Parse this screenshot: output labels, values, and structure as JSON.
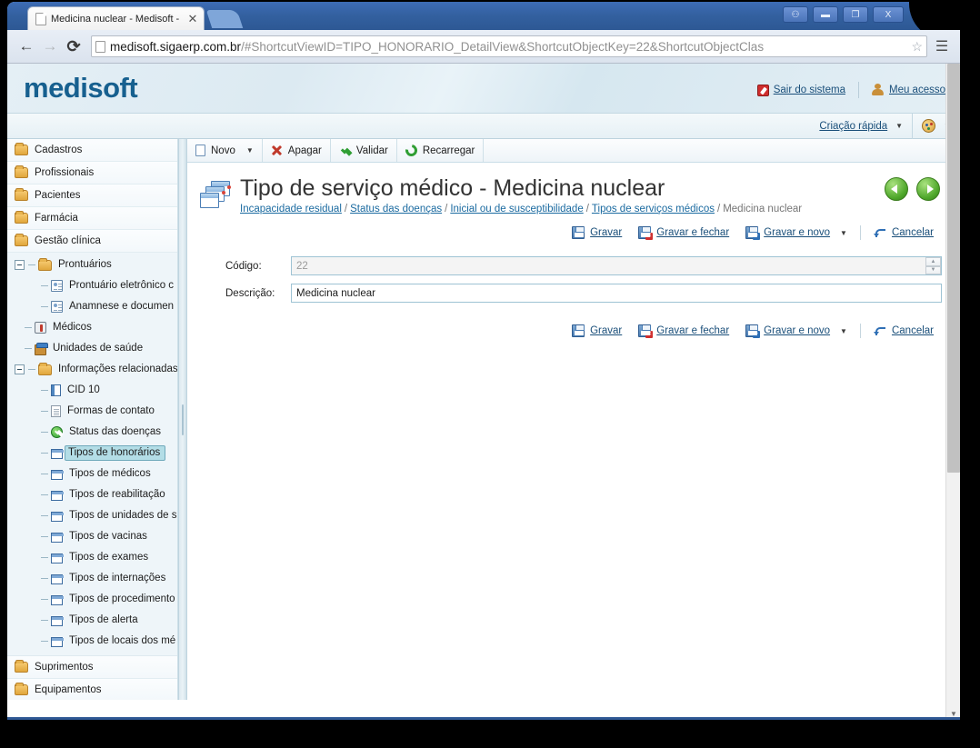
{
  "browser": {
    "tab": {
      "title": "Medicina nuclear - Medisoft -",
      "close_label": "✕",
      "favicon": "page-icon"
    },
    "nav": {
      "back": "←",
      "forward": "→",
      "reload": "⟳",
      "menu": "☰",
      "star": "☆"
    },
    "url": {
      "host": "medisoft.sigaerp.com.br",
      "rest": "/#ShortcutViewID=TIPO_HONORARIO_DetailView&ShortcutObjectKey=22&ShortcutObjectClas"
    },
    "window_controls": {
      "user": "⚇",
      "minimize": "▬",
      "restore": "❐",
      "close": "X"
    }
  },
  "app": {
    "brand": "medisoft",
    "header_links": [
      {
        "label": "Sair do sistema",
        "icon": "exit-icon"
      },
      {
        "label": "Meu acesso",
        "icon": "user-icon"
      }
    ],
    "sub_header": {
      "quick_create": "Criação rápida",
      "caret": "▼",
      "theme_icon": "palette-icon"
    }
  },
  "sidebar": {
    "roots_top": [
      {
        "label": "Cadastros",
        "icon": "folder-icon"
      },
      {
        "label": "Profissionais",
        "icon": "folder-icon"
      },
      {
        "label": "Pacientes",
        "icon": "folder-icon"
      },
      {
        "label": "Farmácia",
        "icon": "folder-icon"
      },
      {
        "label": "Gestão clínica",
        "icon": "folder-icon"
      }
    ],
    "tree": [
      {
        "label": "Prontuários",
        "icon": "folder-icon",
        "level": 1,
        "expander": "minus",
        "selected": false
      },
      {
        "label": "Prontuário eletrônico c",
        "icon": "card-icon",
        "level": 2,
        "expander": "none",
        "selected": false
      },
      {
        "label": "Anamnese e documen",
        "icon": "card-icon",
        "level": 2,
        "expander": "none",
        "selected": false
      },
      {
        "label": "Médicos",
        "icon": "doctor-icon",
        "level": 1,
        "expander": "none",
        "selected": false
      },
      {
        "label": "Unidades de saúde",
        "icon": "hospital-icon",
        "level": 1,
        "expander": "none",
        "selected": false
      },
      {
        "label": "Informações relacionadas",
        "icon": "folder-icon",
        "level": 1,
        "expander": "minus",
        "selected": false
      },
      {
        "label": "CID 10",
        "icon": "cid-icon",
        "level": 2,
        "expander": "none",
        "selected": false
      },
      {
        "label": "Formas de contato",
        "icon": "doc-icon",
        "level": 2,
        "expander": "none",
        "selected": false
      },
      {
        "label": "Status das doenças",
        "icon": "check-icon",
        "level": 2,
        "expander": "none",
        "selected": false
      },
      {
        "label": "Tipos de honorários",
        "icon": "stack-icon",
        "level": 2,
        "expander": "none",
        "selected": true
      },
      {
        "label": "Tipos de médicos",
        "icon": "stack-icon",
        "level": 2,
        "expander": "none",
        "selected": false
      },
      {
        "label": "Tipos de reabilitação",
        "icon": "stack-icon",
        "level": 2,
        "expander": "none",
        "selected": false
      },
      {
        "label": "Tipos de unidades de s",
        "icon": "stack-icon",
        "level": 2,
        "expander": "none",
        "selected": false
      },
      {
        "label": "Tipos de vacinas",
        "icon": "stack-icon",
        "level": 2,
        "expander": "none",
        "selected": false
      },
      {
        "label": "Tipos de exames",
        "icon": "stack-icon",
        "level": 2,
        "expander": "none",
        "selected": false
      },
      {
        "label": "Tipos de internações",
        "icon": "stack-icon",
        "level": 2,
        "expander": "none",
        "selected": false
      },
      {
        "label": "Tipos de procedimento",
        "icon": "stack-icon",
        "level": 2,
        "expander": "none",
        "selected": false
      },
      {
        "label": "Tipos de alerta",
        "icon": "stack-icon",
        "level": 2,
        "expander": "none",
        "selected": false
      },
      {
        "label": "Tipos de locais dos mé",
        "icon": "stack-icon",
        "level": 2,
        "expander": "none",
        "selected": false
      }
    ],
    "roots_bottom": [
      {
        "label": "Suprimentos",
        "icon": "folder-icon"
      },
      {
        "label": "Equipamentos",
        "icon": "folder-icon"
      }
    ]
  },
  "toolbar": {
    "new_label": "Novo",
    "new_caret": "▼",
    "delete_label": "Apagar",
    "validate_label": "Validar",
    "reload_label": "Recarregar"
  },
  "page": {
    "title": "Tipo de serviço médico - Medicina nuclear",
    "icon": "window-stack-icon",
    "breadcrumbs": [
      {
        "label": "Incapacidade residual",
        "link": true
      },
      {
        "label": "Status das doenças",
        "link": true
      },
      {
        "label": "Inicial ou de susceptibilidade",
        "link": true
      },
      {
        "label": "Tipos de serviços médicos",
        "link": true
      }
    ],
    "breadcrumb_separator": "/",
    "breadcrumb_current": "Medicina nuclear",
    "nav_back": "back-arrow-icon",
    "nav_forward": "forward-arrow-icon"
  },
  "actions": {
    "save": "Gravar",
    "save_close": "Gravar e fechar",
    "save_new": "Gravar e novo",
    "save_new_caret": "▼",
    "cancel": "Cancelar"
  },
  "form": {
    "codigo_label": "Código:",
    "codigo_value": "22",
    "codigo_readonly": true,
    "descricao_label": "Descrição:",
    "descricao_value": "Medicina nuclear",
    "spinner_up": "▲",
    "spinner_down": "▼"
  },
  "scrollbar": {
    "down_arrow": "▼"
  },
  "colors": {
    "brand": "#17608f",
    "link": "#1a4f7a",
    "selection": "#b3dde6",
    "accent_green": "#4ea72a",
    "titlebar": "#33609f"
  }
}
